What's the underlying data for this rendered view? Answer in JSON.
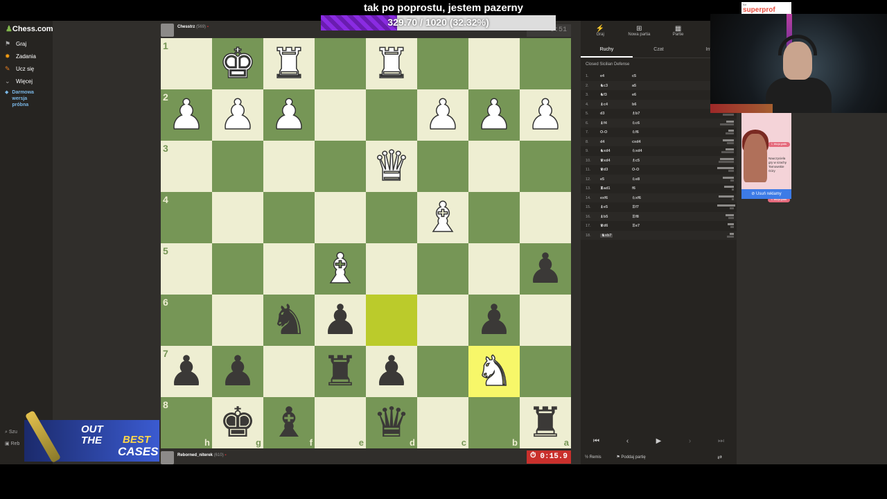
{
  "overlay": {
    "title": "tak po poprostu, jestem pazerny",
    "progress_text": "329.70 / 1020 (32.32%)",
    "progress": 0.3232
  },
  "sidebar": {
    "logo": "Chess.com",
    "items": [
      {
        "label": "Graj",
        "icon": "play-icon"
      },
      {
        "label": "Zadania",
        "icon": "puzzle-icon"
      },
      {
        "label": "Ucz się",
        "icon": "learn-icon"
      },
      {
        "label": "Więcej",
        "icon": "chevron-down-icon"
      }
    ],
    "trial": [
      "Darmowa",
      "wersja",
      "próbna"
    ],
    "bottom": [
      "Szu",
      "Reb"
    ]
  },
  "top_player": {
    "name": "Chesstrz",
    "rating": "(569)",
    "clock": "0:51"
  },
  "bottom_player": {
    "name": "Reborned_niterek",
    "rating": "(610)",
    "clock": "0:15.9"
  },
  "board": {
    "ranks": [
      "1",
      "2",
      "3",
      "4",
      "5",
      "6",
      "7",
      "8"
    ],
    "files": [
      "h",
      "g",
      "f",
      "e",
      "d",
      "c",
      "b",
      "a"
    ],
    "pieces": {
      "0,1": "wK",
      "0,2": "wR",
      "0,4": "wR",
      "1,0": "wP",
      "1,1": "wP",
      "1,2": "wP",
      "1,5": "wP",
      "1,6": "wP",
      "1,7": "wP",
      "2,4": "wQ",
      "3,5": "wB",
      "4,3": "wB",
      "4,7": "bP",
      "5,2": "bN",
      "5,3": "bP",
      "5,6": "bP",
      "6,0": "bP",
      "6,1": "bP",
      "6,3": "bR",
      "6,4": "bP",
      "6,6": "wN",
      "7,1": "bK",
      "7,2": "bB",
      "7,4": "bQ",
      "7,7": "bR"
    },
    "highlights": [
      "5,4",
      "6,6"
    ]
  },
  "right_panel": {
    "top_tabs": [
      {
        "label": "Graj",
        "icon": "play-icon"
      },
      {
        "label": "Nowa partia",
        "icon": "plus-icon"
      },
      {
        "label": "Partie",
        "icon": "grid-icon"
      },
      {
        "label": "",
        "icon": "users-icon"
      }
    ],
    "sub_tabs": [
      "Ruchy",
      "Czat",
      "Infor"
    ],
    "opening": "Closed Sicilian Defense",
    "moves": [
      {
        "n": "1.",
        "w": "e4",
        "b": "c5"
      },
      {
        "n": "2.",
        "w": "♞c3",
        "b": "a5"
      },
      {
        "n": "3.",
        "w": "♞f3",
        "b": "e6"
      },
      {
        "n": "4.",
        "w": "♝c4",
        "b": "b6"
      },
      {
        "n": "5.",
        "w": "d3",
        "b": "♗b7"
      },
      {
        "n": "6.",
        "w": "♝f4",
        "b": "♘c6"
      },
      {
        "n": "7.",
        "w": "O-O",
        "b": "♘f6"
      },
      {
        "n": "8.",
        "w": "d4",
        "b": "cxd4"
      },
      {
        "n": "9.",
        "w": "♞xd4",
        "b": "♘xd4"
      },
      {
        "n": "10.",
        "w": "♛xd4",
        "b": "♗c5"
      },
      {
        "n": "11.",
        "w": "♛d3",
        "b": "O-O"
      },
      {
        "n": "12.",
        "w": "e5",
        "b": "♘e8"
      },
      {
        "n": "13.",
        "w": "♜ad1",
        "b": "f6"
      },
      {
        "n": "14.",
        "w": "exf6",
        "b": "♘xf6"
      },
      {
        "n": "15.",
        "w": "♝e5",
        "b": "♖f7"
      },
      {
        "n": "16.",
        "w": "♝b5",
        "b": "♖f8"
      },
      {
        "n": "17.",
        "w": "♛d6",
        "b": "♖e7"
      },
      {
        "n": "18.",
        "w": "♞xb7",
        "b": ""
      }
    ],
    "actions": {
      "draw": "Remis",
      "resign": "Poddaj partię"
    }
  },
  "ads": {
    "top_label": "Ad",
    "top_brand": "superprof",
    "side_pills": [
      "1. lekcja gratis",
      "1. lekcja gratis"
    ],
    "side_text": [
      "Nauczyciela",
      "gry w szachy",
      "Tarnowskie",
      "Góry"
    ],
    "remove": "Usuń reklamy"
  },
  "promo": {
    "line1": "OUT",
    "line2": "THE",
    "line3": "BEST",
    "line4": "CASES"
  }
}
